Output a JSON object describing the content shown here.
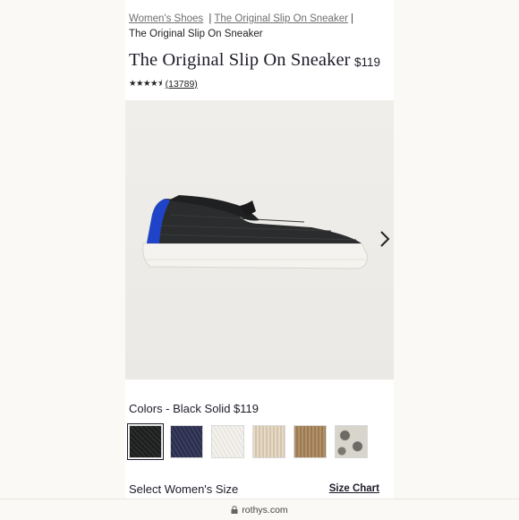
{
  "breadcrumb": {
    "items": [
      "Women's Shoes",
      "The Original Slip On Sneaker"
    ],
    "current": "The Original Slip On Sneaker"
  },
  "product": {
    "title": "The Original Slip On Sneaker",
    "price": "$119",
    "rating": 4.5,
    "stars": "★★★★⯨",
    "review_count": "(13789)"
  },
  "colors": {
    "label": "Colors - Black Solid $119",
    "selected_index": 0,
    "swatches": [
      "Black Solid",
      "Navy",
      "White",
      "Cream",
      "Camel",
      "Snake"
    ]
  },
  "size": {
    "label": "Select Women's Size",
    "chart_link": "Size Chart"
  },
  "browser": {
    "url": "rothys.com",
    "icon": "lock-icon"
  },
  "theme": {
    "text": "#1c1c2a",
    "background": "#fbf9f5",
    "accent_heel": "#1f44c9"
  }
}
